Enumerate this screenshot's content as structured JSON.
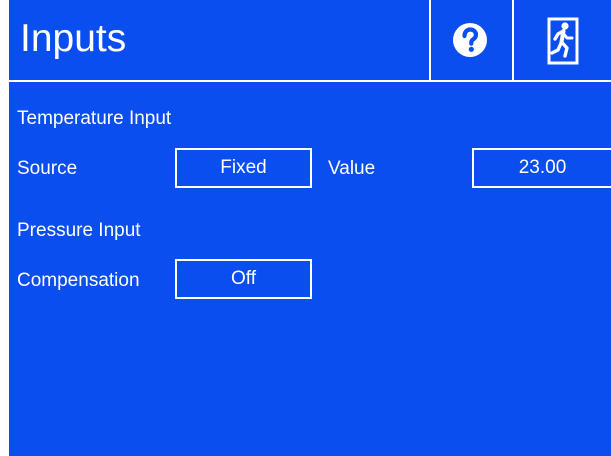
{
  "header": {
    "title": "Inputs",
    "help_icon": "question-circle-icon",
    "exit_icon": "exit-door-icon"
  },
  "temperature": {
    "section_label": "Temperature Input",
    "source_label": "Source",
    "source_value": "Fixed",
    "value_label": "Value",
    "value": "23.00"
  },
  "pressure": {
    "section_label": "Pressure Input",
    "compensation_label": "Compensation",
    "compensation_value": "Off"
  },
  "colors": {
    "background": "#0a4ef0",
    "foreground": "#ffffff"
  }
}
